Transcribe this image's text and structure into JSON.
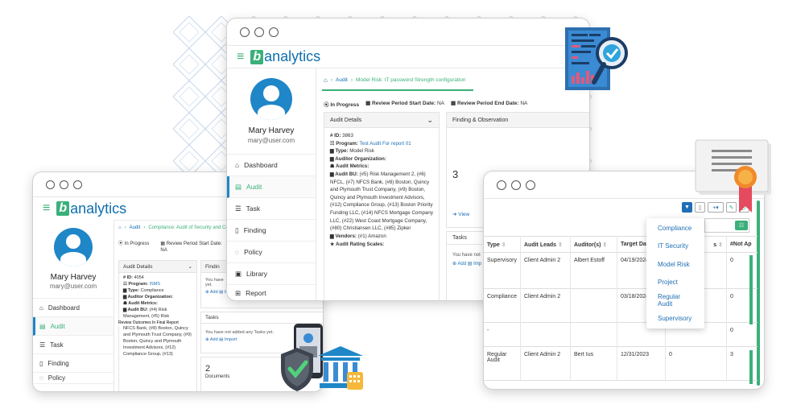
{
  "brand": {
    "b": "b",
    "text": "analytics"
  },
  "user": {
    "name": "Mary Harvey",
    "email": "mary@user.com"
  },
  "nav": [
    "Dashboard",
    "Audit",
    "Task",
    "Finding",
    "Policy",
    "Library",
    "Report"
  ],
  "main": {
    "breadcrumb": [
      "Audit",
      "Model Risk: IT password Strength configuration"
    ],
    "status": "In Progress",
    "review_start_label": "Review Period Start Date:",
    "review_start_value": "NA",
    "review_end_label": "Review Period End Date:",
    "review_end_value": "NA",
    "audit_details_title": "Audit Details",
    "id_label": "ID:",
    "id_value": "3863",
    "program_label": "Program:",
    "program_value": "Test Audit For report 01",
    "type_label": "Type:",
    "type_value": "Model Risk",
    "org_label": "Auditor Organization:",
    "metrics_label": "Audit Metrics:",
    "bu_label": "Audit BU:",
    "bu_value": "(#5) Risk Management 2, (#6) NFCL, (#7) NFCS Bank, (#8) Boston, Quincy and Plymouth Trust Company, (#9) Boston, Quincy and Plymouth Investment Advisors, (#12) Compliance Group, (#13) Boston Priority Funding LLC, (#14) NFCS Mortgage Company LLC, (#22) West Coast Mortgage Company, (#80) Christiansen LLC, (#85) Zipker",
    "vendors_label": "Vendors:",
    "vendors_value": "(#1) Amazon",
    "rating_label": "Audit Rating Scales:",
    "finding_title": "Finding & Observation",
    "finding_count": "3",
    "view_label": "View",
    "tasks_title": "Tasks",
    "tasks_empty": "You have not",
    "add_label": "Add",
    "import_label": "Imp"
  },
  "left": {
    "breadcrumb": [
      "Audit",
      "Compliance: Audit of Security and Co"
    ],
    "status": "In Progress",
    "review_start_label": "Review Period Start Date:",
    "review_start_value": "NA",
    "review_extra": "R",
    "review_extra_value": "N",
    "audit_details_title": "Audit Details",
    "id_label": "ID:",
    "id_value": "4054",
    "program_label": "Program:",
    "program_value": "ISMS",
    "type_label": "Type:",
    "type_value": "Compliance",
    "org_label": "Auditor Organization:",
    "metrics_label": "Audit Metrics:",
    "bu_label": "Audit BU:",
    "bu_value": "(#4) Risk Management, (#5) Risk",
    "tooltip": "Review Outcomes In Final Report",
    "bu_value_2": "NFCS Bank, (#8) Boston, Quincy and Plymouth Trust Company, (#9) Boston, Quincy and Plymouth Investment Advisors, (#12) Compliance Group, (#13)",
    "finding_title": "Findin",
    "findings_empty": "You have not added any Findings yet.",
    "findings_empty_short": "You have",
    "findings_empty_short2": "yet.",
    "add_label": "Add",
    "import_label": "Import",
    "tasks_title": "Tasks",
    "tasks_empty": "You have not added any Tasks yet.",
    "docs_count": "2",
    "docs_label": "Documents"
  },
  "table": {
    "headers": [
      "Type",
      "Audit Leads",
      "Auditor(s)",
      "Target Date",
      "s",
      "#Not Ap"
    ],
    "rows": [
      [
        "Supervisory",
        "Client Admin 2",
        "Albert Estoff",
        "04/19/2024",
        "",
        "0"
      ],
      [
        "Compliance",
        "Client Admin 2",
        "",
        "03/18/2024",
        "",
        "0"
      ],
      [
        "-",
        "",
        "",
        "",
        "",
        "0"
      ],
      [
        "Regular Audit",
        "Client Admin 2",
        "Bert Ius",
        "12/31/2023",
        "0",
        "3"
      ]
    ],
    "dropdown": [
      "Compliance",
      "IT Security",
      "Model Risk",
      "Project",
      "Regular Audit",
      "Supervisory"
    ]
  },
  "colors": {
    "green": "#3bb07a",
    "blue": "#1f86c8",
    "navy": "#0e6fae"
  }
}
